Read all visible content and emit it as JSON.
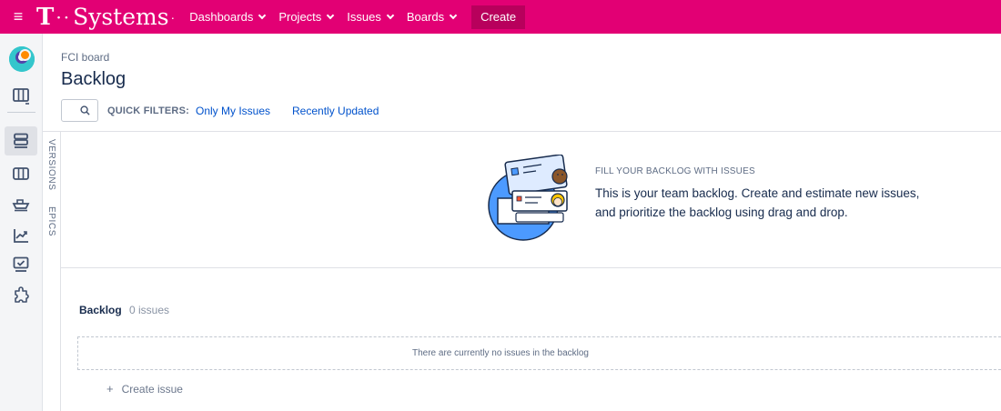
{
  "topbar": {
    "brand_t": "T",
    "brand_dots": "··",
    "brand_name": "Systems",
    "brand_end": "·",
    "nav": [
      {
        "label": "Dashboards"
      },
      {
        "label": "Projects"
      },
      {
        "label": "Issues"
      },
      {
        "label": "Boards"
      }
    ],
    "create_label": "Create",
    "color": "#e20074"
  },
  "sidebar": {
    "items": [
      {
        "icon": "board-icon"
      },
      {
        "icon": "backlog-icon"
      },
      {
        "icon": "active-sprints-icon"
      },
      {
        "icon": "releases-icon"
      },
      {
        "icon": "reports-icon"
      },
      {
        "icon": "issues-icon"
      },
      {
        "icon": "add-ons-icon"
      }
    ]
  },
  "header": {
    "breadcrumb": "FCI board",
    "title": "Backlog",
    "quick_filters_label": "QUICK FILTERS:",
    "filters": [
      "Only My Issues",
      "Recently Updated"
    ]
  },
  "side_tabs": {
    "versions": "VERSIONS",
    "epics": "EPICS"
  },
  "empty_state": {
    "heading": "FILL YOUR BACKLOG WITH ISSUES",
    "line1": "This is your team backlog. Create and estimate new issues,",
    "line2": "and prioritize the backlog using drag and drop."
  },
  "backlog": {
    "title": "Backlog",
    "count": "0 issues",
    "empty_text": "There are currently no issues in the backlog",
    "create_label": "Create issue"
  }
}
